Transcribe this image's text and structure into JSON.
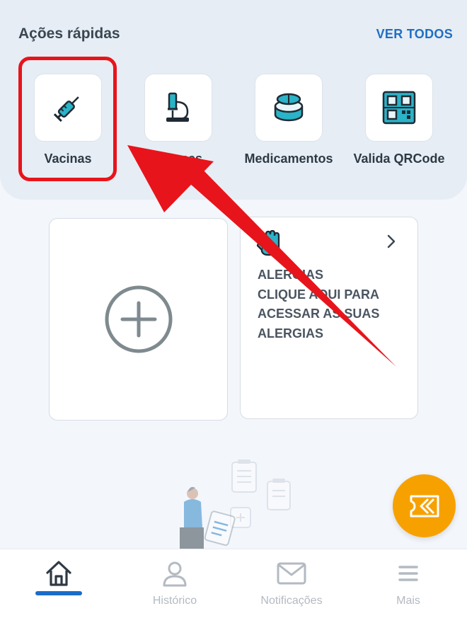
{
  "quick_actions": {
    "title": "Ações rápidas",
    "see_all": "VER TODOS",
    "items": [
      {
        "label": "Vacinas",
        "icon": "syringe-icon"
      },
      {
        "label": "Exames",
        "icon": "microscope-icon"
      },
      {
        "label": "Medicamentos",
        "icon": "pills-icon"
      },
      {
        "label": "Valida QRCode",
        "icon": "qrcode-icon"
      }
    ]
  },
  "cards": {
    "add_icon": "plus-circle-icon",
    "allergy": {
      "icon": "hand-icon",
      "title": "ALERGIAS",
      "line1": "CLIQUE AQUI PARA",
      "line2": "ACESSAR AS SUAS",
      "line3": "ALERGIAS"
    }
  },
  "bottom_nav": {
    "items": [
      {
        "label": "",
        "icon": "home-icon",
        "active": true
      },
      {
        "label": "Histórico",
        "icon": "user-icon"
      },
      {
        "label": "Notificações",
        "icon": "mail-icon"
      },
      {
        "label": "Mais",
        "icon": "menu-icon"
      }
    ]
  },
  "colors": {
    "accent": "#1a6cc9",
    "fab": "#f7a100",
    "highlight": "#e8141b",
    "icon_teal": "#2bb3c8"
  }
}
